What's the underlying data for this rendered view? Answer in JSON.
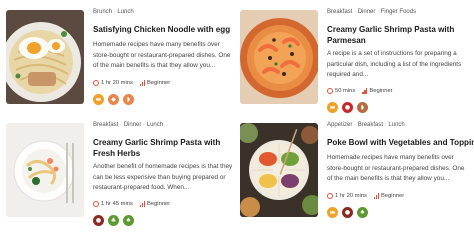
{
  "cards": [
    {
      "tags": [
        "Brunch",
        "Lunch"
      ],
      "title": "Satisfying Chicken Noodle with egg",
      "description": "Homemade recipes have many benefits over store-bought or restaurant-prepared dishes. One of the main benefits is that they allow you...",
      "time": "1 hr 20 mins",
      "level": "Beginner",
      "icons": [
        "bread-icon",
        "fish-icon",
        "shrimp-icon"
      ]
    },
    {
      "tags": [
        "Breakfast",
        "Dinner",
        "Finger Foods"
      ],
      "title": "Creamy Garlic Shrimp Pasta with Parmesan",
      "description": "A recipe is a set of instructions for preparing a particular dish, including a list of the ingredients required and...",
      "time": "50 mins",
      "level": "Beginner",
      "icons": [
        "bread-icon",
        "pepper-icon",
        "shrimp-icon"
      ]
    },
    {
      "tags": [
        "Breakfast",
        "Dinner",
        "Lunch"
      ],
      "title": "Creamy Garlic Shrimp Pasta with Fresh Herbs",
      "description": "Another benefit of homemade recipes is that they can be less expensive than buying prepared or restaurant-prepared food. When...",
      "time": "1 hr 45 mins",
      "level": "Beginner",
      "icons": [
        "pepper-icon",
        "herb-icon",
        "leaf-icon"
      ]
    },
    {
      "tags": [
        "Appetizer",
        "Breakfast",
        "Lunch"
      ],
      "title": "Poke Bowl with Vegetables and Toppings",
      "description": "Homemade recipes have many benefits over store-bought or restaurant-prepared dishes. One of the main benefits is that they allow you...",
      "time": "1 hr 20 mins",
      "level": "Beginner",
      "icons": [
        "bread-icon",
        "pepper-icon",
        "leaf-icon"
      ]
    }
  ],
  "colors": {
    "accent": "#e0533a",
    "title": "#1b1b1b",
    "text": "#444444"
  }
}
